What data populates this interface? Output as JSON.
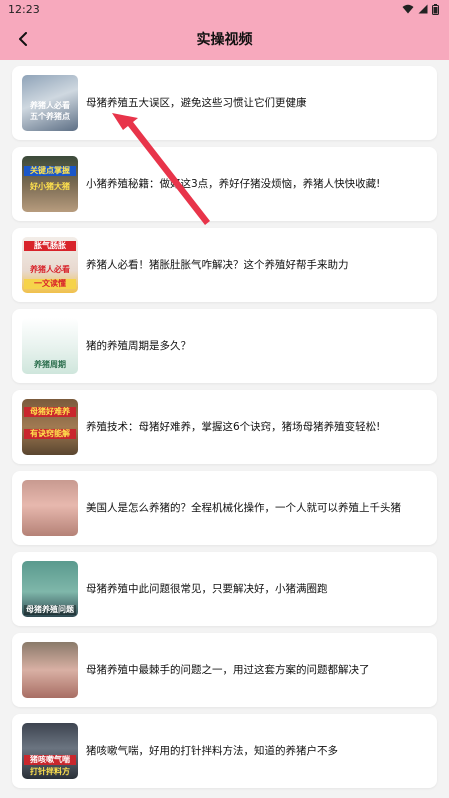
{
  "status_bar": {
    "time": "12:23"
  },
  "header": {
    "title": "实操视频"
  },
  "videos": [
    {
      "title": "母猪养殖五大误区，避免这些习惯让它们更健康",
      "thumb_text": [
        "养猪人必看",
        "五个养猪点"
      ]
    },
    {
      "title": "小猪养殖秘籍：做好这3点，养好仔猪没烦恼，养猪人快快收藏!",
      "thumb_text": [
        "关键点掌握",
        "好小猪大猪"
      ]
    },
    {
      "title": "养猪人必看！猪胀肚胀气咋解决？这个养殖好帮手来助力",
      "thumb_text": [
        "胀气肠胀",
        "养猪人必看",
        "一文读懂"
      ]
    },
    {
      "title": "猪的养殖周期是多久？",
      "thumb_text": [
        "养猪周期"
      ]
    },
    {
      "title": "养殖技术：母猪好难养，掌握这6个诀窍，猪场母猪养殖变轻松!",
      "thumb_text": [
        "母猪好难养",
        "有诀窍能解"
      ]
    },
    {
      "title": "美国人是怎么养猪的？全程机械化操作，一个人就可以养殖上千头猪",
      "thumb_text": []
    },
    {
      "title": "母猪养殖中此问题很常见，只要解决好，小猪满圈跑",
      "thumb_text": [
        "母猪养殖问题"
      ]
    },
    {
      "title": "母猪养殖中最棘手的问题之一，用过这套方案的问题都解决了",
      "thumb_text": []
    },
    {
      "title": "猪咳嗽气喘，好用的打针拌料方法，知道的养猪户不多",
      "thumb_text": [
        "猪咳嗽气喘",
        "打针拌料方"
      ]
    }
  ],
  "colors": {
    "header_bg": "#f7a9bd",
    "arrow": "#e8344a"
  }
}
